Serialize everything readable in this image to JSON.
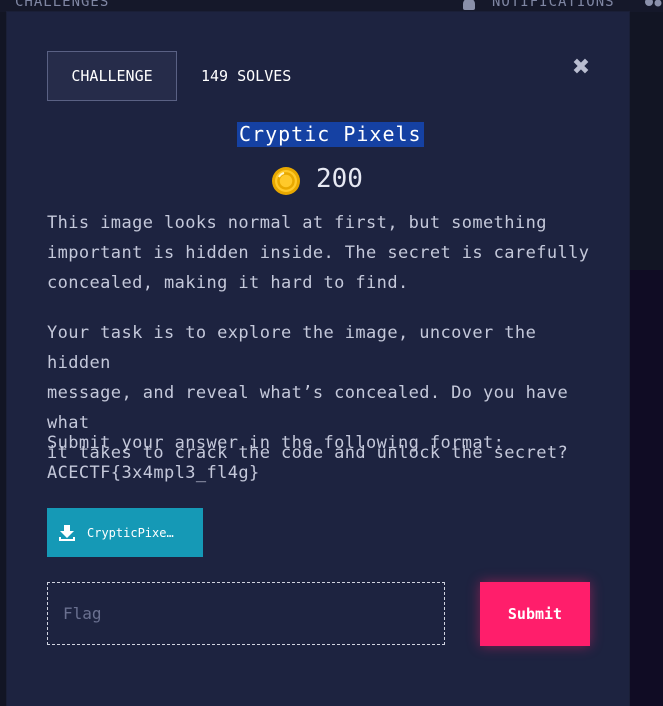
{
  "topbar": {
    "challenges_label": "CHALLENGES",
    "notifications_label": "NOTIFICATIONS",
    "bell_icon": "bell-icon",
    "users_icon": "users-icon"
  },
  "modal": {
    "tabs": {
      "challenge_label": "CHALLENGE",
      "solves_label": "149 SOLVES"
    },
    "close_icon": "close-icon",
    "title": "Cryptic Pixels",
    "points": "200",
    "coin_icon": "coin-icon",
    "description": {
      "p1": "This image looks normal at first, but something\nimportant is hidden inside. The secret is carefully\nconcealed, making it hard to find.",
      "p2": "Your task is to explore the image, uncover the hidden\nmessage, and reveal what’s concealed. Do you have what\nit takes to crack the code and unlock the secret?",
      "p3": "Submit your answer in the following format:\nACECTF{3x4mpl3_fl4g}"
    },
    "download": {
      "label": "CrypticPixe…",
      "icon": "download-icon"
    },
    "flag_input": {
      "value": "",
      "placeholder": "Flag"
    },
    "submit_label": "Submit"
  },
  "colors": {
    "modal_bg": "#1d2340",
    "title_highlight": "#1541a3",
    "download_button": "#1599b6",
    "submit_button": "#ff1e6b"
  }
}
